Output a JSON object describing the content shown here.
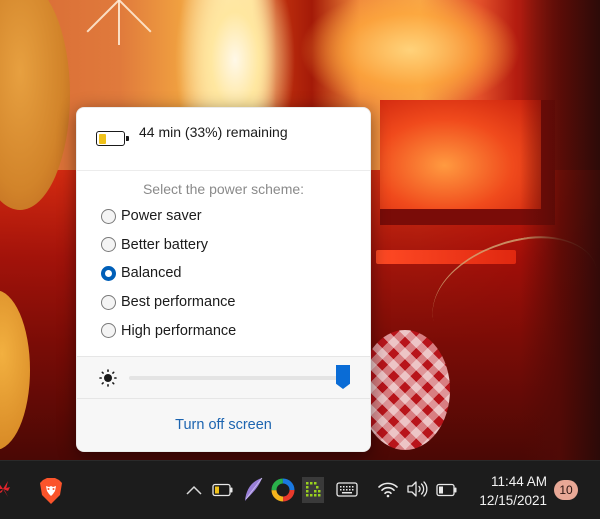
{
  "flyout": {
    "battery_icon": "battery-icon",
    "battery_level_fraction": 0.33,
    "battery_text": "44 min (33%) remaining",
    "scheme_title": "Select the power scheme:",
    "schemes": [
      {
        "label": "Power saver",
        "selected": false
      },
      {
        "label": "Better battery",
        "selected": false
      },
      {
        "label": "Balanced",
        "selected": true
      },
      {
        "label": "Best performance",
        "selected": false
      },
      {
        "label": "High performance",
        "selected": false
      }
    ],
    "brightness_icon": "sun-icon",
    "brightness_value": 1.0,
    "turn_off_label": "Turn off screen",
    "accent_color": "#005fb8",
    "link_color": "#1c64b0"
  },
  "taskbar": {
    "pinned_apps": [
      {
        "name": "huawei-icon"
      },
      {
        "name": "brave-browser-icon"
      }
    ],
    "tray_icons": [
      {
        "name": "show-hidden-icons-chevron-up-icon"
      },
      {
        "name": "battery-tray-icon"
      },
      {
        "name": "feather-app-icon"
      },
      {
        "name": "color-circle-app-icon"
      },
      {
        "name": "green-g-app-icon"
      },
      {
        "name": "touch-keyboard-icon"
      },
      {
        "name": "wifi-icon"
      },
      {
        "name": "volume-icon"
      },
      {
        "name": "battery-status-icon"
      }
    ],
    "time": "11:44 AM",
    "date": "12/15/2021",
    "notification_count": "10"
  }
}
